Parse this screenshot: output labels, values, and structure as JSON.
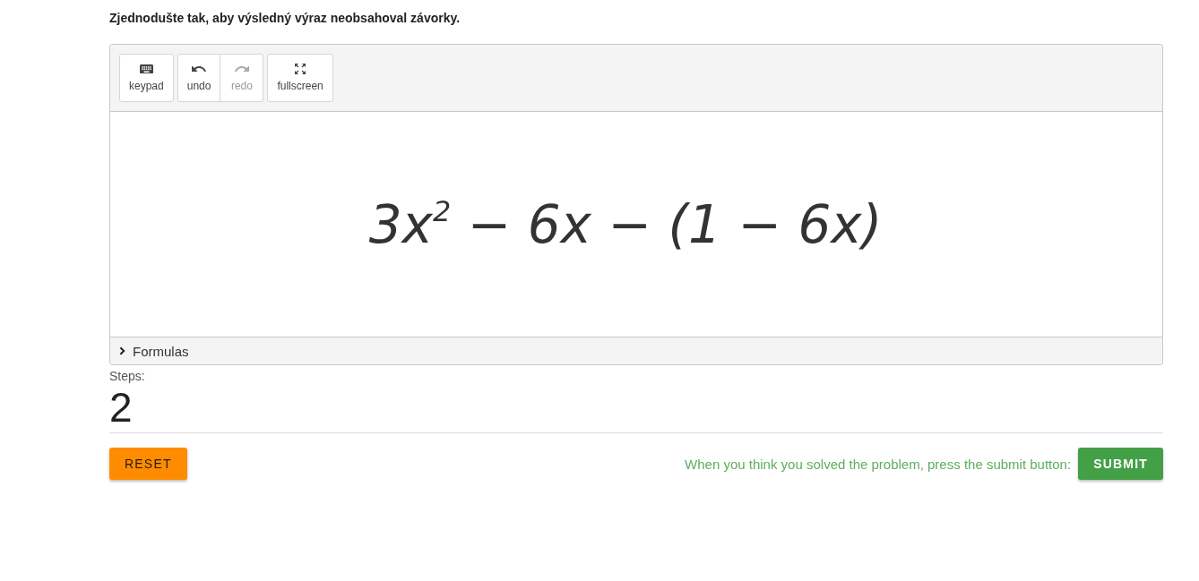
{
  "instruction": "Zjednodušte tak, aby výsledný výraz neobsahoval závorky.",
  "toolbar": {
    "groups": [
      {
        "buttons": [
          {
            "kind": "keypad",
            "label": "keypad",
            "disabled": false
          }
        ]
      },
      {
        "buttons": [
          {
            "kind": "undo",
            "label": "undo",
            "disabled": false
          },
          {
            "kind": "redo",
            "label": "redo",
            "disabled": true
          }
        ]
      },
      {
        "buttons": [
          {
            "kind": "fullscreen",
            "label": "fullscreen",
            "disabled": false
          }
        ]
      }
    ]
  },
  "expression": "3x$^{2}$ − 6x − (1 − 6x)",
  "formulas": {
    "label": "Formulas",
    "expanded": false
  },
  "steps": {
    "label": "Steps:",
    "value": "2"
  },
  "reset_button": "RESET",
  "submit_hint": "When you think you solved the problem, press the submit button:",
  "submit_button": "SUBMIT"
}
